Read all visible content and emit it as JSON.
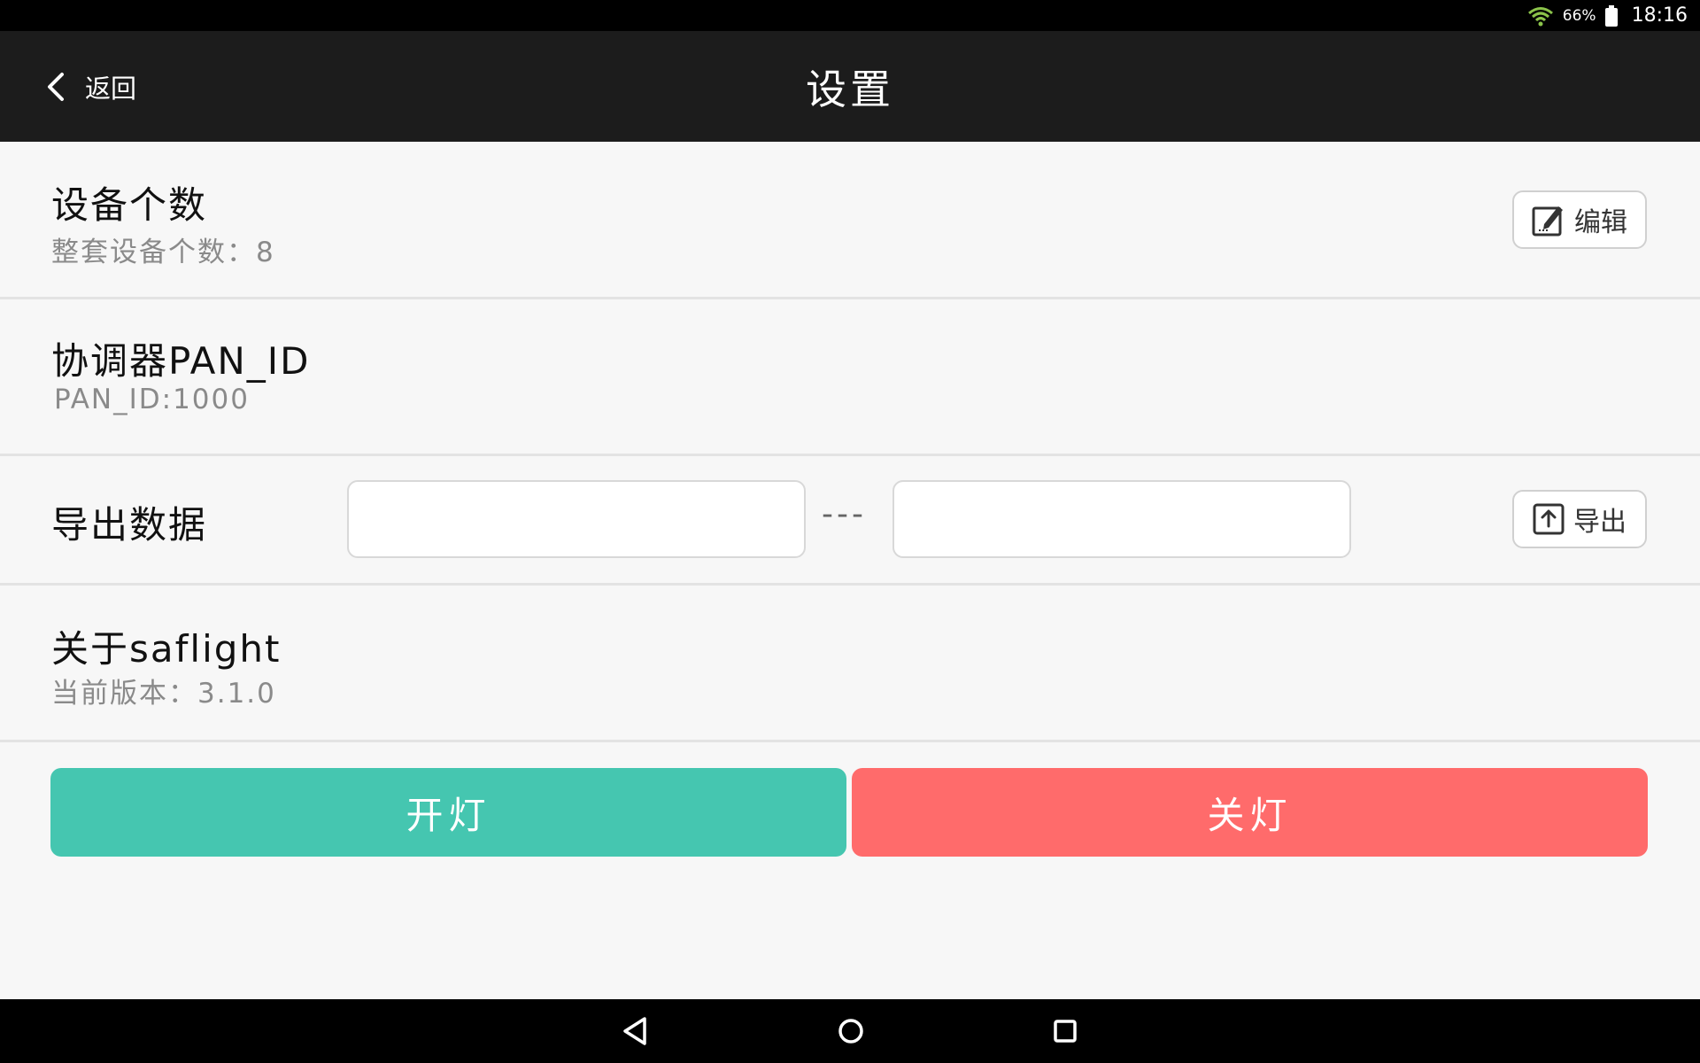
{
  "status_bar": {
    "battery": "66%",
    "time": "18:16"
  },
  "header": {
    "back_label": "返回",
    "title": "设置"
  },
  "device_count": {
    "title": "设备个数",
    "subtitle": "整套设备个数：8",
    "edit_label": "编辑"
  },
  "pan_id": {
    "title": "协调器PAN_ID",
    "subtitle": "PAN_ID:1000"
  },
  "export": {
    "title": "导出数据",
    "from_value": "",
    "separator": "---",
    "to_value": "",
    "button_label": "导出"
  },
  "about": {
    "title": "关于saflight",
    "subtitle": "当前版本：3.1.0"
  },
  "actions": {
    "on_label": "开灯",
    "off_label": "关灯",
    "on_color": "#45c6b0",
    "off_color": "#ff6b6b"
  }
}
